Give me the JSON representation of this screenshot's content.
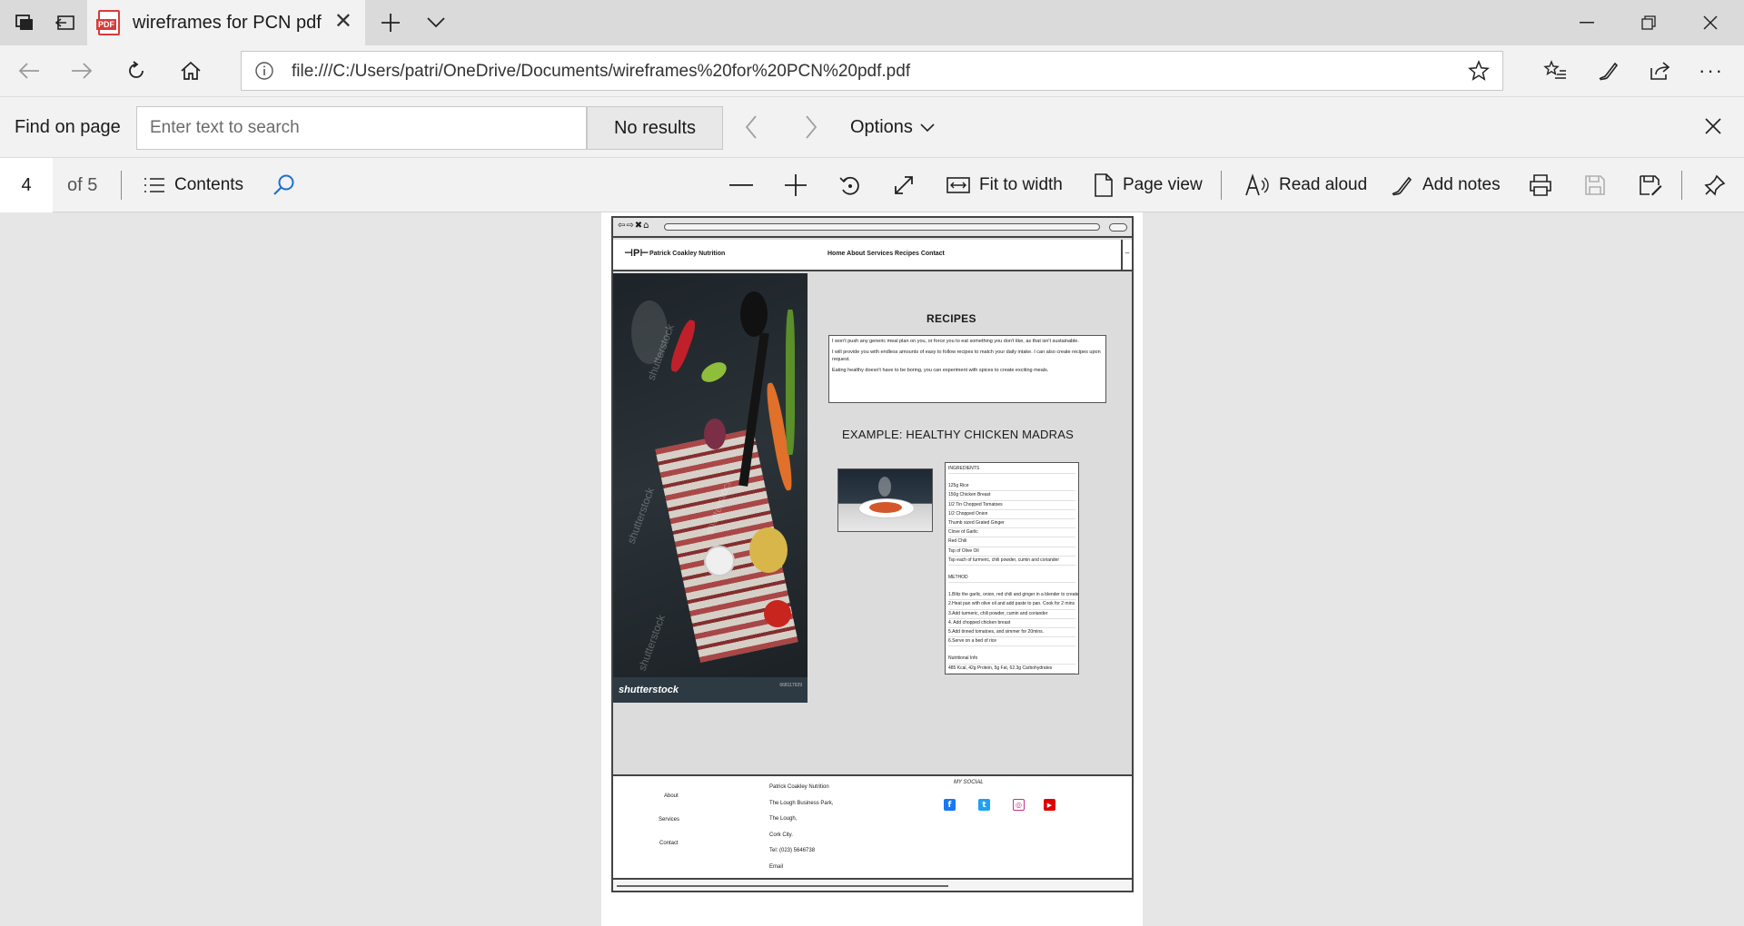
{
  "browser": {
    "tab_title": "wireframes for PCN pdf",
    "address_url": "file:///C:/Users/patri/OneDrive/Documents/wireframes%20for%20PCN%20pdf.pdf"
  },
  "find_bar": {
    "label": "Find on page",
    "placeholder": "Enter text to search",
    "results": "No results",
    "options_label": "Options"
  },
  "pdf_toolbar": {
    "page_number": "4",
    "page_total": "of 5",
    "contents_label": "Contents",
    "fit_label": "Fit to width",
    "page_view_label": "Page view",
    "read_aloud_label": "Read aloud",
    "add_notes_label": "Add notes"
  },
  "wireframe": {
    "brand": "Patrick Coakley Nutrition",
    "nav": "Home  About  Services Recipes Contact",
    "photo_logo": "shutterstock",
    "photo_watermark": "shutterstock",
    "photo_code": "668117929",
    "recipes_title": "RECIPES",
    "intro": [
      "I won't push any generic meal plan on you, or force you to eat something you don't like, as that isn't sustainable.",
      "I will provide you with endless amounts of easy to follow recipes to match your daily intake. I can also create recipes upon request.",
      "Eating healthy doesn't have to be boring, you can experiment with spices to create exciting meals."
    ],
    "example_title": "EXAMPLE: HEALTHY CHICKEN MADRAS",
    "ingredients_heading": "INGREDIENTS",
    "ingredients": [
      "125g Rice",
      "150g Chicken Breast",
      "1/2 Tin Chopped Tomatoes",
      "1/2 Chopped Onion",
      "Thumb sized Grated Ginger",
      "Clove of Garlic",
      "Red Chili",
      "Tsp of Olive Oil",
      "Tsp each of turmeric, chili powder, cumin and coriander"
    ],
    "method_heading": "METHOD",
    "method": [
      "1.Blitz the garlic, onion, red chili and ginger in a blender to create a paste",
      "2.Heat pan with olive oil and add paste to pan. Cook for 2 mins",
      "3.Add turmeric, chili powder, cumin and coriander",
      "4. Add chopped chicken breast",
      "5.Add tinned tomatoes, and simmer for 20mins.",
      "6.Serve on a bed of rice"
    ],
    "nutrition_heading": "Nutritional Info",
    "nutrition": "485 Kcal, 42g Protein, 5g Fat, 62.3g Carbohydrates",
    "footer": {
      "links": [
        "About",
        "Services",
        "Contact"
      ],
      "address": [
        "Patrick Coakley Nutrition",
        "The Lough Business Park,",
        "The Lough,",
        "Cork City.",
        "Tel: (023) 5646738",
        "Email"
      ],
      "social_title": "MY SOCIAL"
    }
  },
  "colors": {
    "facebook": "#1877f2",
    "twitter": "#1da1f2",
    "instagram": "#c13584",
    "youtube": "#e00000",
    "accent_search": "#1f6fd0"
  }
}
